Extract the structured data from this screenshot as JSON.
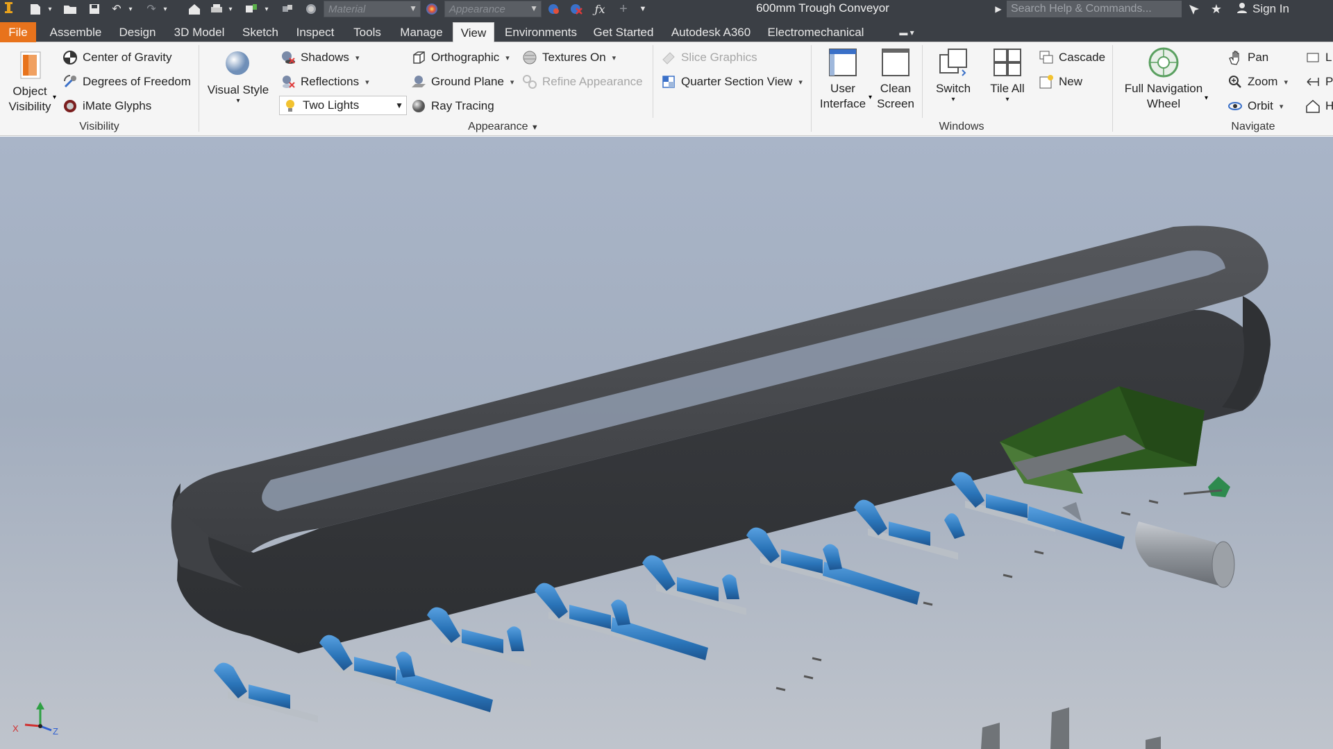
{
  "app": {
    "document_title": "600mm Trough Conveyor",
    "material_placeholder": "Material",
    "appearance_placeholder": "Appearance",
    "search_placeholder": "Search Help & Commands...",
    "sign_in": "Sign In",
    "brand_color": "#e8731c"
  },
  "tabs": [
    {
      "label": "File"
    },
    {
      "label": "Assemble"
    },
    {
      "label": "Design"
    },
    {
      "label": "3D Model"
    },
    {
      "label": "Sketch"
    },
    {
      "label": "Inspect"
    },
    {
      "label": "Tools"
    },
    {
      "label": "Manage"
    },
    {
      "label": "View"
    },
    {
      "label": "Environments"
    },
    {
      "label": "Get Started"
    },
    {
      "label": "Autodesk A360"
    },
    {
      "label": "Electromechanical"
    }
  ],
  "active_tab": "View",
  "ribbon": {
    "visibility": {
      "title": "Visibility",
      "object_visibility": "Object Visibility",
      "center_of_gravity": "Center of Gravity",
      "degrees_of_freedom": "Degrees of Freedom",
      "imate_glyphs": "iMate Glyphs"
    },
    "appearance": {
      "title": "Appearance",
      "visual_style": "Visual Style",
      "shadows": "Shadows",
      "reflections": "Reflections",
      "lighting_value": "Two Lights",
      "orthographic": "Orthographic",
      "ground_plane": "Ground Plane",
      "ray_tracing": "Ray Tracing",
      "textures_on": "Textures On",
      "refine_appearance": "Refine Appearance",
      "slice_graphics": "Slice Graphics",
      "quarter_section_view": "Quarter Section View"
    },
    "windows": {
      "title": "Windows",
      "user_interface": "User Interface",
      "clean_screen": "Clean Screen",
      "switch": "Switch",
      "tile_all": "Tile All",
      "cascade": "Cascade",
      "new": "New"
    },
    "navigate": {
      "title": "Navigate",
      "full_navigation_wheel": "Full Navigation Wheel",
      "pan": "Pan",
      "zoom": "Zoom",
      "orbit": "Orbit",
      "cut_1": "L",
      "cut_2": "P",
      "cut_3": "H"
    }
  },
  "viewcube_axes": {
    "x": "X",
    "z": "Z"
  },
  "model": {
    "belt_color": "#4a4c50",
    "roller_color": "#2f7fc1",
    "frame_color": "#b9bfc6",
    "hopper_color": "#2d5a1f"
  }
}
